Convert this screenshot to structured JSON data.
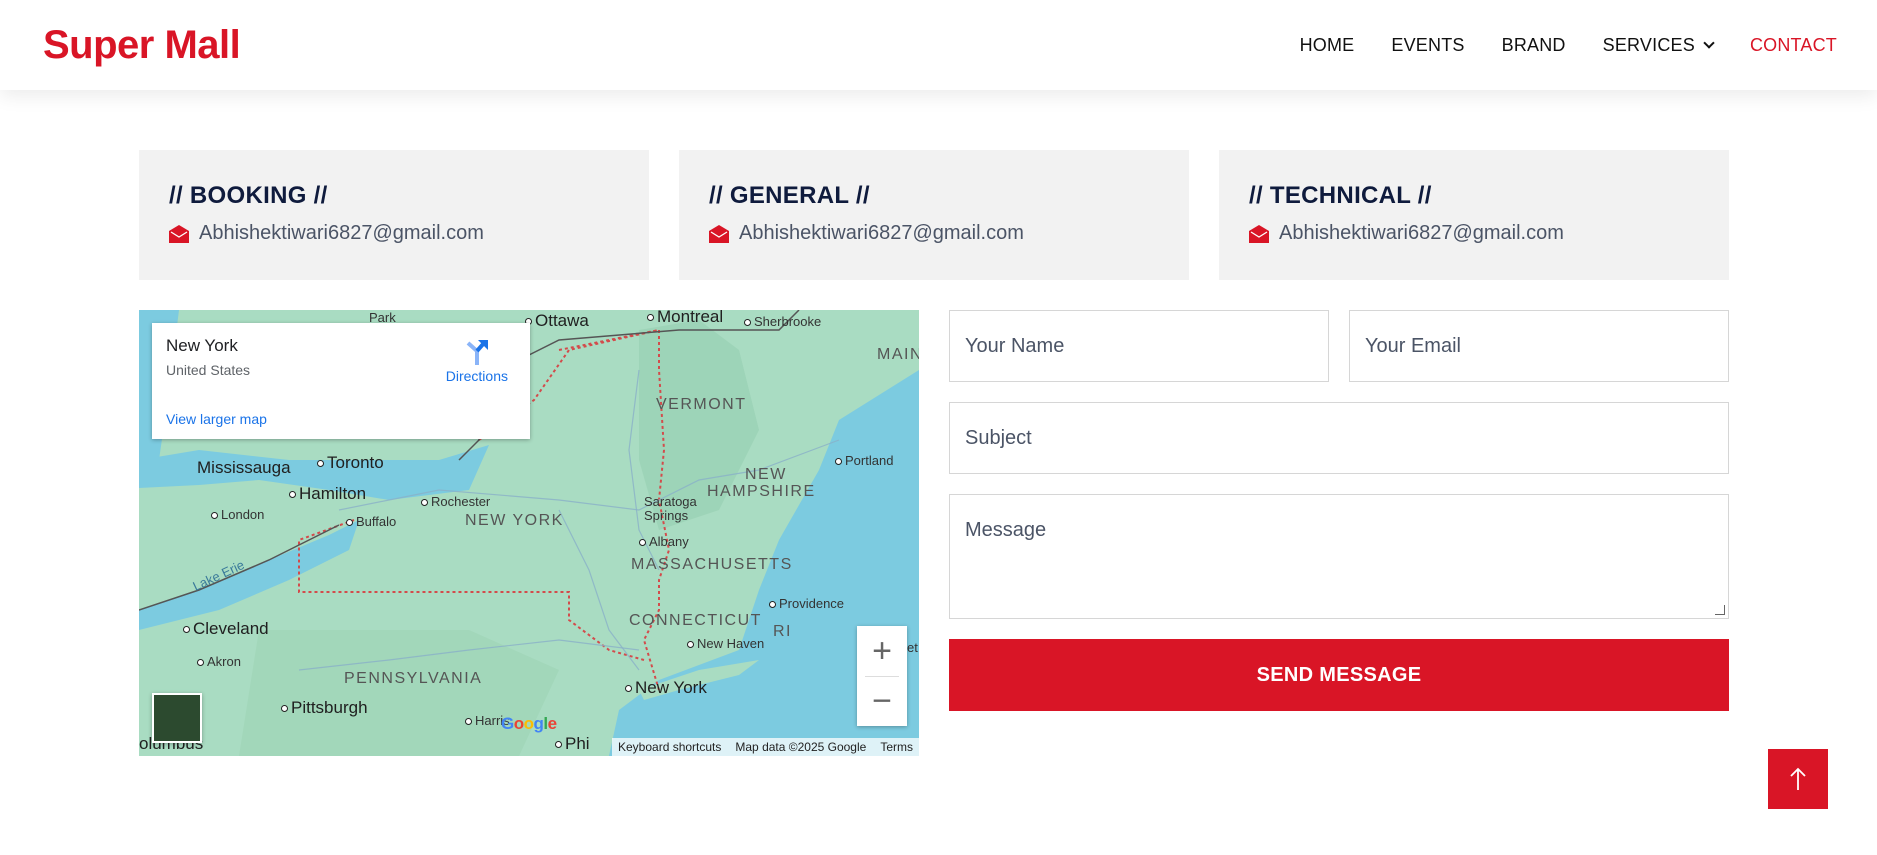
{
  "header": {
    "brand": "Super Mall",
    "nav": [
      "HOME",
      "EVENTS",
      "BRAND",
      "SERVICES",
      "CONTACT"
    ],
    "active": "CONTACT"
  },
  "cards": [
    {
      "title": "// BOOKING //",
      "email": "Abhishektiwari6827@gmail.com"
    },
    {
      "title": "// GENERAL //",
      "email": "Abhishektiwari6827@gmail.com"
    },
    {
      "title": "// TECHNICAL //",
      "email": "Abhishektiwari6827@gmail.com"
    }
  ],
  "map": {
    "info": {
      "city": "New York",
      "country": "United States",
      "directions": "Directions",
      "larger": "View larger map"
    },
    "places": [
      "Ottawa",
      "Montreal",
      "Sherbrooke",
      "MAIN",
      "VERMONT",
      "NEW",
      "HAMPSHIRE",
      "Portland",
      "Mississauga",
      "Toronto",
      "Hamilton",
      "Rochester",
      "NEW YORK",
      "London",
      "Buffalo",
      "Saratoga",
      "Springs",
      "Albany",
      "MASSACHUSETTS",
      "Lake Erie",
      "Providence",
      "Cleveland",
      "CONNECTICUT",
      "RI",
      "New Haven",
      "Akron",
      "New York",
      "PENNSYLVANIA",
      "Pittsburgh",
      "Harris",
      "olumbus",
      "Phi",
      "Park",
      "et"
    ],
    "attribution": [
      "Keyboard shortcuts",
      "Map data ©2025 Google",
      "Terms"
    ],
    "google": "Google",
    "zoom_in": "+",
    "zoom_out": "−"
  },
  "form": {
    "name_placeholder": "Your Name",
    "email_placeholder": "Your Email",
    "subject_placeholder": "Subject",
    "message_placeholder": "Message",
    "send": "SEND MESSAGE"
  },
  "colors": {
    "accent": "#d91526",
    "card_bg": "#f2f2f2",
    "title": "#0f1b3d"
  },
  "icons": {
    "email": "envelope-open-icon",
    "top": "arrow-up-icon"
  }
}
